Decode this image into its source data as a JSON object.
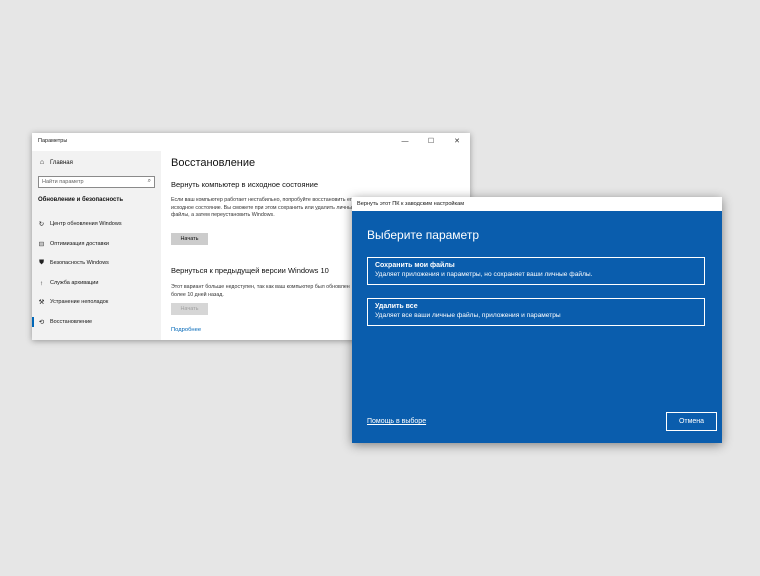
{
  "settings_window": {
    "title": "Параметры",
    "controls": {
      "minimize": "—",
      "maximize": "☐",
      "close": "✕"
    },
    "sidebar": {
      "home_label": "Главная",
      "search_placeholder": "Найти параметр",
      "section_title": "Обновление и безопасность",
      "items": [
        {
          "label": "Центр обновления Windows",
          "icon": "sync-icon"
        },
        {
          "label": "Оптимизация доставки",
          "icon": "delivery-icon"
        },
        {
          "label": "Безопасность Windows",
          "icon": "shield-icon"
        },
        {
          "label": "Служба архивации",
          "icon": "backup-icon"
        },
        {
          "label": "Устранение неполадок",
          "icon": "wrench-icon"
        },
        {
          "label": "Восстановление",
          "icon": "recovery-icon",
          "active": true
        }
      ]
    },
    "main": {
      "heading": "Восстановление",
      "reset": {
        "title": "Вернуть компьютер в исходное состояние",
        "body": "Если ваш компьютер работает нестабильно, попробуйте восстановить его исходное состояние. Вы сможете при этом сохранить или удалить личные файлы, а затем переустановить Windows.",
        "button": "Начать"
      },
      "rollback": {
        "title": "Вернуться к предыдущей версии Windows 10",
        "body": "Этот вариант больше недоступен, так как ваш компьютер был обновлен более 10 дней назад.",
        "button": "Начать"
      },
      "more_link": "Подробнее"
    }
  },
  "reset_dialog": {
    "title": "Вернуть этот ПК к заводским настройкам",
    "heading": "Выберите параметр",
    "options": [
      {
        "title": "Сохранить мои файлы",
        "description": "Удаляет приложения и параметры, но сохраняет ваши личные файлы."
      },
      {
        "title": "Удалить все",
        "description": "Удаляет все ваши личные файлы, приложения и параметры"
      }
    ],
    "help_link": "Помощь в выборе",
    "cancel": "Отмена"
  },
  "colors": {
    "accent": "#0067b8",
    "dialog_bg": "#0a5dad",
    "sidebar_bg": "#f2f2f2",
    "desktop_bg": "#e6e6e6"
  }
}
